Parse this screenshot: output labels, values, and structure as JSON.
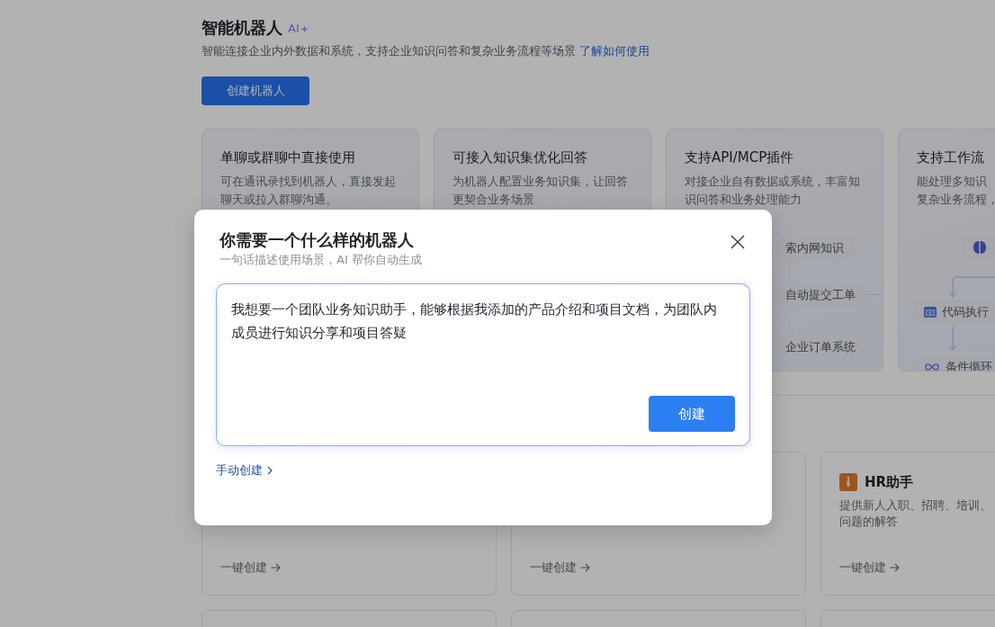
{
  "page": {
    "title": "智能机器人",
    "ai_badge": "AI",
    "description": "智能连接企业内外数据和系统，支持企业知识问答和复杂业务流程等场景",
    "learn_link": "了解如何使用",
    "create_button": "创建机器人"
  },
  "feature_cards": [
    {
      "kind": "plain",
      "title": "单聊或群聊中直接使用",
      "description_lines": [
        "可在通讯录找到机器人，直接发起",
        "聊天或拉入群聊沟通。"
      ]
    },
    {
      "kind": "plain",
      "title": "可接入知识集优化回答",
      "description_lines": [
        "为机器人配置业务知识集，让回答",
        "更契合业务场景"
      ]
    },
    {
      "kind": "plugins",
      "title": "支持API/MCP插件",
      "description_lines": [
        "对接企业自有数据或系统，丰富知",
        "识问答和业务处理能力"
      ],
      "chips": [
        "索内网知识",
        "自动提交工单",
        "企业订单系统"
      ]
    },
    {
      "kind": "workflow",
      "title": "支持工作流",
      "description_lines": [
        "能处理多知识",
        "复杂业务流程，"
      ],
      "chips": [
        "代码执行",
        "条件循环"
      ]
    }
  ],
  "templates": [
    {
      "action": "一键创建"
    },
    {
      "action": "一键创建"
    },
    {
      "title": "HR助手",
      "description_lines": [
        "提供新人入职、招聘、培训、",
        "问题的解答"
      ],
      "action": "一键创建"
    }
  ],
  "dialog": {
    "title": "你需要一个什么样的机器人",
    "subtitle": "一句话描述使用场景，AI 帮你自动生成",
    "prompt": "我想要一个团队业务知识助手，能够根据我添加的产品介绍和项目文档，为团队内成员进行知识分享和项目答疑",
    "submit": "创建",
    "manual_link": "手动创建"
  }
}
